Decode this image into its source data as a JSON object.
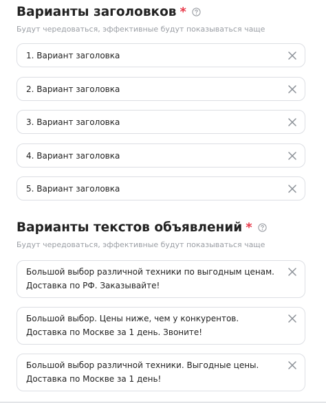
{
  "headlines": {
    "title": "Варианты заголовков",
    "required_mark": "*",
    "help_icon": "question-circle-icon",
    "hint": "Будут чередоваться, эффективные будут показываться чаще",
    "items": [
      {
        "value": "1. Вариант заголовка"
      },
      {
        "value": "2. Вариант заголовка"
      },
      {
        "value": "3. Вариант заголовка"
      },
      {
        "value": "4. Вариант заголовка"
      },
      {
        "value": "5. Вариант заголовка"
      }
    ],
    "clear_icon": "close-icon"
  },
  "ad_texts": {
    "title": "Варианты текстов объявлений",
    "required_mark": "*",
    "help_icon": "question-circle-icon",
    "hint": "Будут чередоваться, эффективные будут показываться чаще",
    "items": [
      {
        "value": "Большой выбор различной техники по выгодным ценам.\nДоставка по РФ. Заказывайте!"
      },
      {
        "value": "Большой выбор. Цены ниже, чем у конкурентов.\nДоставка по Москве за 1 день. Звоните!"
      },
      {
        "value": "Большой выбор различной техники. Выгодные цены.\nДоставка по Москве за 1 день!"
      }
    ],
    "clear_icon": "close-icon"
  },
  "colors": {
    "required": "#e8394a",
    "hint": "#9a9ea4",
    "border": "#dcdee3",
    "icon": "#8a8f96"
  }
}
